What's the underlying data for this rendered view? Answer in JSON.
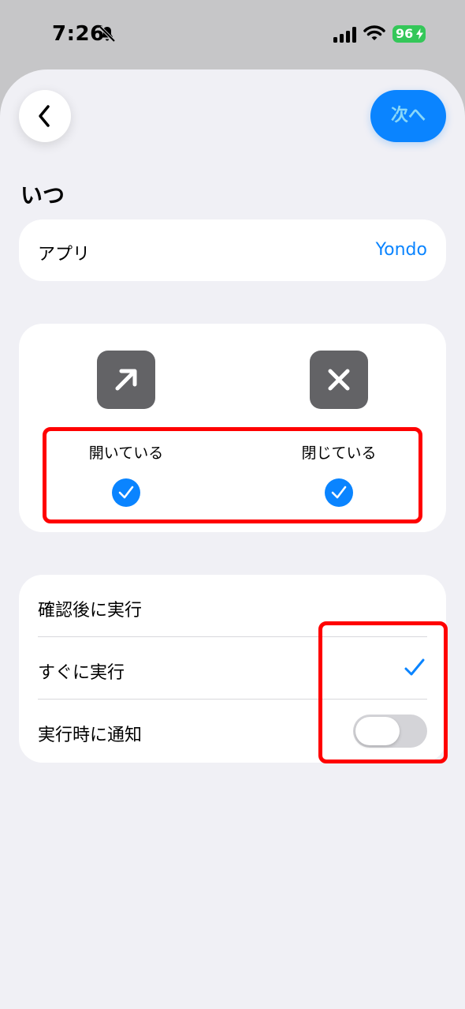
{
  "status_bar": {
    "time": "7:26",
    "battery_level": "96",
    "icons": [
      "bell-slash-icon",
      "signal-icon",
      "wifi-icon",
      "battery-charging-icon"
    ]
  },
  "nav": {
    "back_icon": "chevron-left-icon",
    "next_label": "次へ"
  },
  "section": {
    "title": "いつ"
  },
  "app_row": {
    "label": "アプリ",
    "value": "Yondo"
  },
  "states": [
    {
      "icon": "arrow-up-right-icon",
      "label": "開いている",
      "checked": true
    },
    {
      "icon": "xmark-icon",
      "label": "閉じている",
      "checked": true
    }
  ],
  "options": [
    {
      "label": "確認後に実行",
      "selected": false
    },
    {
      "label": "すぐに実行",
      "selected": true
    },
    {
      "label": "実行時に通知",
      "toggle_on": false
    }
  ],
  "colors": {
    "accent": "#0a84ff",
    "highlight": "#ff0000",
    "icon_bg": "#636366",
    "battery": "#34c759",
    "background": "#f0f0f5"
  }
}
